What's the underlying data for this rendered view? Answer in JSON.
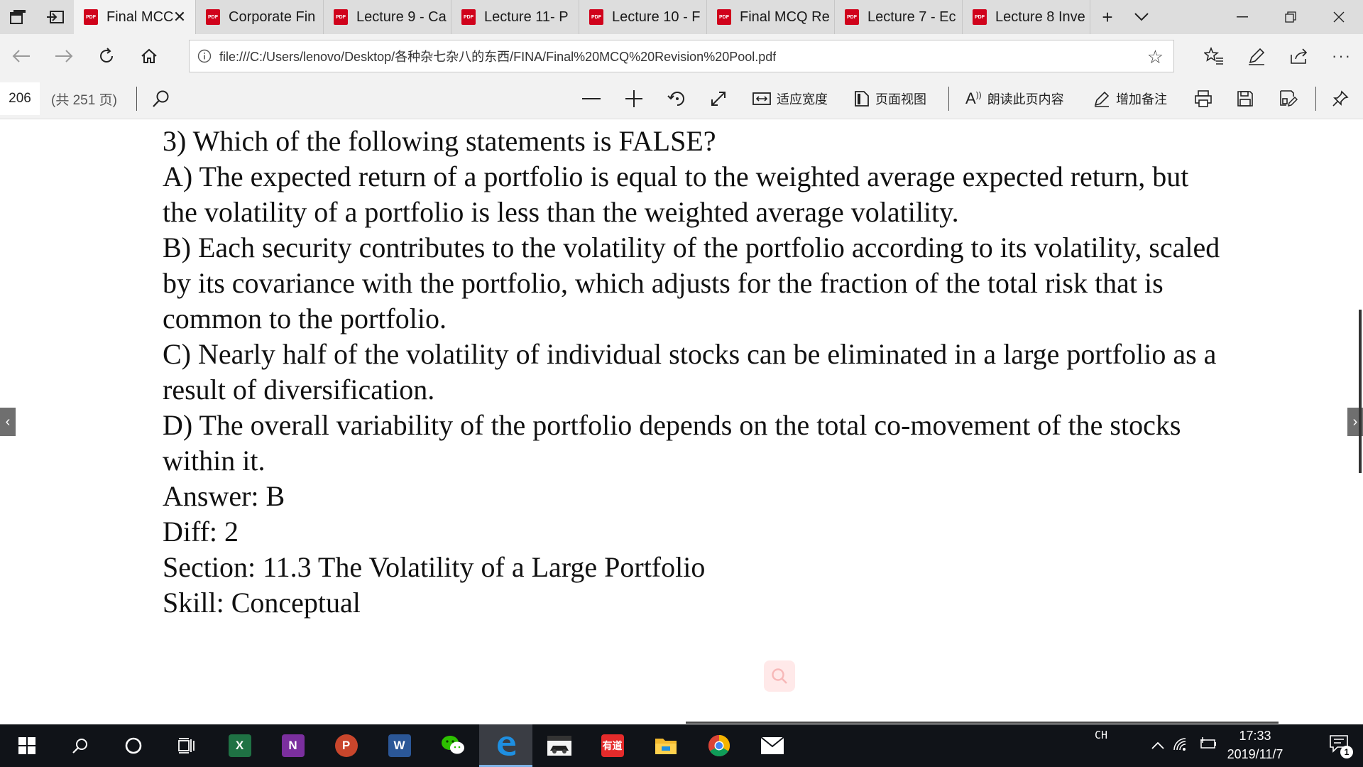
{
  "tabs": {
    "items": [
      {
        "label": "Final MCC",
        "active": true
      },
      {
        "label": "Corporate Fin",
        "active": false
      },
      {
        "label": "Lecture 9 - Ca",
        "active": false
      },
      {
        "label": "Lecture 11- P",
        "active": false
      },
      {
        "label": "Lecture 10 - F",
        "active": false
      },
      {
        "label": "Final MCQ Re",
        "active": false
      },
      {
        "label": "Lecture 7 - Ec",
        "active": false
      },
      {
        "label": "Lecture 8 Inve",
        "active": false
      }
    ],
    "pdf_badge": "PDF",
    "new_tab_icon": "plus-icon",
    "tab_list_icon": "chevron-down-icon"
  },
  "window": {
    "minimize": "—",
    "restore": "❐",
    "close": "✕"
  },
  "address": {
    "url": "file:///C:/Users/lenovo/Desktop/各种杂七杂八的东西/FINA/Final%20MCQ%20Revision%20Pool.pdf",
    "info_icon": "info-icon",
    "favorite_icon": "star-icon"
  },
  "pdf_toolbar": {
    "page_number": "206",
    "page_total": "(共 251 页)",
    "fit_width_label": "适应宽度",
    "page_view_label": "页面视图",
    "read_aloud_label": "朗读此页内容",
    "add_notes_label": "增加备注"
  },
  "document": {
    "lines": [
      "3) Which of the following statements is FALSE?",
      "A) The expected return of a portfolio is equal to the weighted average expected return, but",
      "the volatility of a portfolio is less than the weighted average volatility.",
      "B) Each security contributes to the volatility of the portfolio according to its volatility, scaled",
      "by its covariance with the portfolio, which adjusts for the fraction of the total risk that is",
      "common to the portfolio.",
      "C) Nearly half of the volatility of individual stocks can be eliminated in a large portfolio as a",
      "result of diversification.",
      "D) The overall variability of the portfolio depends on the total co-movement of the stocks",
      "within it.",
      "Answer:  B",
      "Diff: 2",
      "Section:  11.3 The Volatility of a Large Portfolio",
      "Skill:  Conceptual"
    ]
  },
  "taskbar": {
    "apps": [
      {
        "name": "excel",
        "glyph": "X",
        "color": "#1f7244"
      },
      {
        "name": "onenote",
        "glyph": "N",
        "color": "#7b2f9e"
      },
      {
        "name": "powerpoint",
        "glyph": "P",
        "color": "#c9462c"
      },
      {
        "name": "word",
        "glyph": "W",
        "color": "#2b5797"
      }
    ],
    "youdao_label": "有道",
    "ime": "CH",
    "time": "17:33",
    "date": "2019/11/7",
    "notification_count": "1"
  }
}
